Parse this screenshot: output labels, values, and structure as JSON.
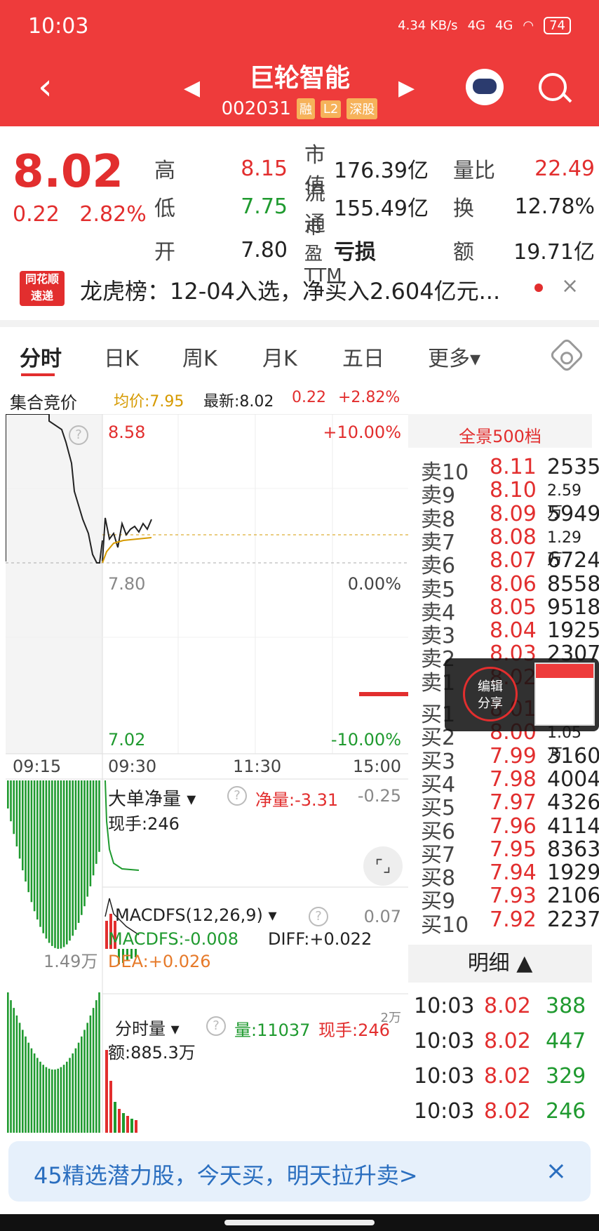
{
  "status_bar": {
    "time": "10:03",
    "net_speed": "4.34\nKB/s",
    "signal1": "4G",
    "signal2": "4G",
    "battery": "74"
  },
  "header": {
    "title": "巨轮智能",
    "code": "002031",
    "badges": [
      "融",
      "L2",
      "深股"
    ]
  },
  "quote": {
    "price": "8.02",
    "change": "0.22",
    "change_pct": "2.82%",
    "rows": [
      {
        "l1": "高",
        "v1": "8.15",
        "l2": "市值",
        "v2": "176.39亿",
        "l3": "量比",
        "v3": "22.49"
      },
      {
        "l1": "低",
        "v1": "7.75",
        "l2": "流通",
        "v2": "155.49亿",
        "l3": "换",
        "v3": "12.78%"
      },
      {
        "l1": "开",
        "v1": "7.80",
        "l2": "市盈TTM",
        "v2": "亏损",
        "l3": "额",
        "v3": "19.71亿"
      }
    ]
  },
  "news": {
    "logo_line1": "同花顺",
    "logo_line2": "速递",
    "text": "龙虎榜：12-04入选，净买入2.604亿元..."
  },
  "tabs": [
    "分时",
    "日K",
    "周K",
    "月K",
    "五日",
    "更多▾"
  ],
  "info_row": {
    "auction": "集合竞价",
    "avg": "均价:7.95",
    "latest": "最新:8.02",
    "chg": "0.22",
    "pct": "+2.82%"
  },
  "chart": {
    "y_top": "8.58",
    "y_mid": "7.80",
    "y_bottom": "7.02",
    "pct_top": "+10.00%",
    "pct_mid": "0.00%",
    "pct_bottom": "-10.00%",
    "x_labels": [
      "09:15",
      "09:30",
      "11:30",
      "15:00"
    ],
    "big_order": {
      "label": "大单净量",
      "net_label": "净量:",
      "net": "-3.31",
      "right": "-0.25",
      "hand": "现手:246"
    },
    "macd": {
      "label": "MACDFS(12,26,9)",
      "right": "0.07",
      "macdfs": "MACDFS:-0.008",
      "diff": "DIFF:+0.022",
      "dea": "DEA:+0.026",
      "side": "1.49万"
    },
    "vol": {
      "label": "分时量",
      "vol": "量:11037",
      "hand": "现手:246",
      "amount": "额:885.3万",
      "side": "2万"
    }
  },
  "orderbook": {
    "title": "全景500档",
    "sells": [
      {
        "label": "卖10",
        "price": "8.11",
        "vol": "2535"
      },
      {
        "label": "卖9",
        "price": "8.10",
        "vol": "2.59万"
      },
      {
        "label": "卖8",
        "price": "8.09",
        "vol": "5949"
      },
      {
        "label": "卖7",
        "price": "8.08",
        "vol": "1.29万"
      },
      {
        "label": "卖6",
        "price": "8.07",
        "vol": "6724"
      },
      {
        "label": "卖5",
        "price": "8.06",
        "vol": "8558"
      },
      {
        "label": "卖4",
        "price": "8.05",
        "vol": "9518"
      },
      {
        "label": "卖3",
        "price": "8.04",
        "vol": "1925"
      },
      {
        "label": "卖2",
        "price": "8.03",
        "vol": "2307"
      },
      {
        "label": "卖1",
        "price": "8.02",
        "vol": ""
      }
    ],
    "buys": [
      {
        "label": "买1",
        "price": "8.01",
        "vol": ""
      },
      {
        "label": "买2",
        "price": "8.00",
        "vol": "1.05万"
      },
      {
        "label": "买3",
        "price": "7.99",
        "vol": "3160"
      },
      {
        "label": "买4",
        "price": "7.98",
        "vol": "4004"
      },
      {
        "label": "买5",
        "price": "7.97",
        "vol": "4326"
      },
      {
        "label": "买6",
        "price": "7.96",
        "vol": "4114"
      },
      {
        "label": "买7",
        "price": "7.95",
        "vol": "8363"
      },
      {
        "label": "买8",
        "price": "7.94",
        "vol": "1929"
      },
      {
        "label": "买9",
        "price": "7.93",
        "vol": "2106"
      },
      {
        "label": "买10",
        "price": "7.92",
        "vol": "2237"
      }
    ]
  },
  "detail": {
    "title": "明细 ▲",
    "rows": [
      {
        "time": "10:03",
        "price": "8.02",
        "vol": "388"
      },
      {
        "time": "10:03",
        "price": "8.02",
        "vol": "447"
      },
      {
        "time": "10:03",
        "price": "8.02",
        "vol": "329"
      },
      {
        "time": "10:03",
        "price": "8.02",
        "vol": "246"
      }
    ]
  },
  "overlay": {
    "line1": "编辑",
    "line2": "分享"
  },
  "banner": {
    "text": "45精选潜力股，今天买，明天拉升卖>",
    "close": "×"
  }
}
